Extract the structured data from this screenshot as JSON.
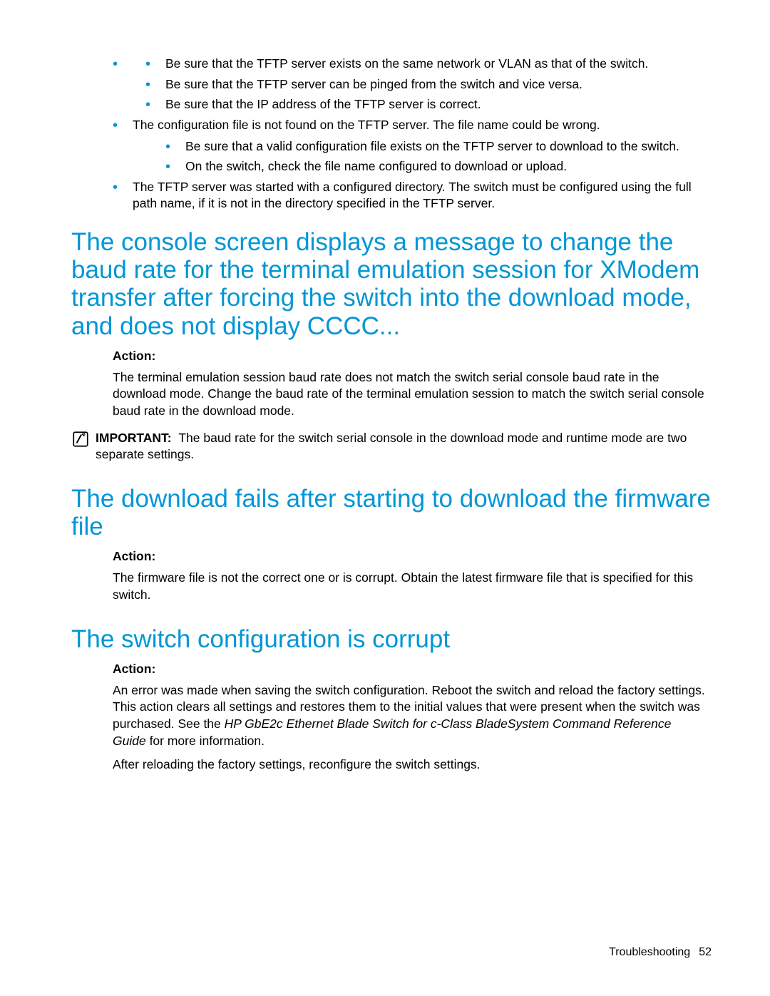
{
  "bullets": {
    "sub1": [
      "Be sure that the TFTP server exists on the same network or VLAN as that of the switch.",
      "Be sure that the TFTP server can be pinged from the switch and vice versa.",
      "Be sure that the IP address of the TFTP server is correct."
    ],
    "outer1": "The configuration file is not found on the TFTP server. The file name could be wrong.",
    "sub2": [
      "Be sure that a valid configuration file exists on the TFTP server to download to the switch.",
      "On the switch, check the file name configured to download or upload."
    ],
    "outer2": "The TFTP server was started with a configured directory. The switch must be configured using the full path name, if it is not in the directory specified in the TFTP server."
  },
  "section1": {
    "heading": "The console screen displays a message to change the baud rate for the terminal emulation session for XModem transfer after forcing the switch into the download mode, and does not display CCCC...",
    "action_label": "Action:",
    "action_text": "The terminal emulation session baud rate does not match the switch serial console baud rate in the download mode. Change the baud rate of the terminal emulation session to match the switch serial console baud rate in the download mode.",
    "important_label": "IMPORTANT:",
    "important_text": "The baud rate for the switch serial console in the download mode and runtime mode are two separate settings."
  },
  "section2": {
    "heading": "The download fails after starting to download the firmware file",
    "action_label": "Action:",
    "action_text": "The firmware file is not the correct one or is corrupt. Obtain the latest firmware file that is specified for this switch."
  },
  "section3": {
    "heading": "The switch configuration is corrupt",
    "action_label": "Action:",
    "action_text_1a": "An error was made when saving the switch configuration. Reboot the switch and reload the factory settings. This action clears all settings and restores them to the initial values that were present when the switch was purchased. See the ",
    "action_text_1b": "HP GbE2c Ethernet Blade Switch for c-Class BladeSystem Command Reference Guide",
    "action_text_1c": " for more information.",
    "action_text_2": "After reloading the factory settings, reconfigure the switch settings."
  },
  "footer": {
    "section": "Troubleshooting",
    "page": "52"
  }
}
